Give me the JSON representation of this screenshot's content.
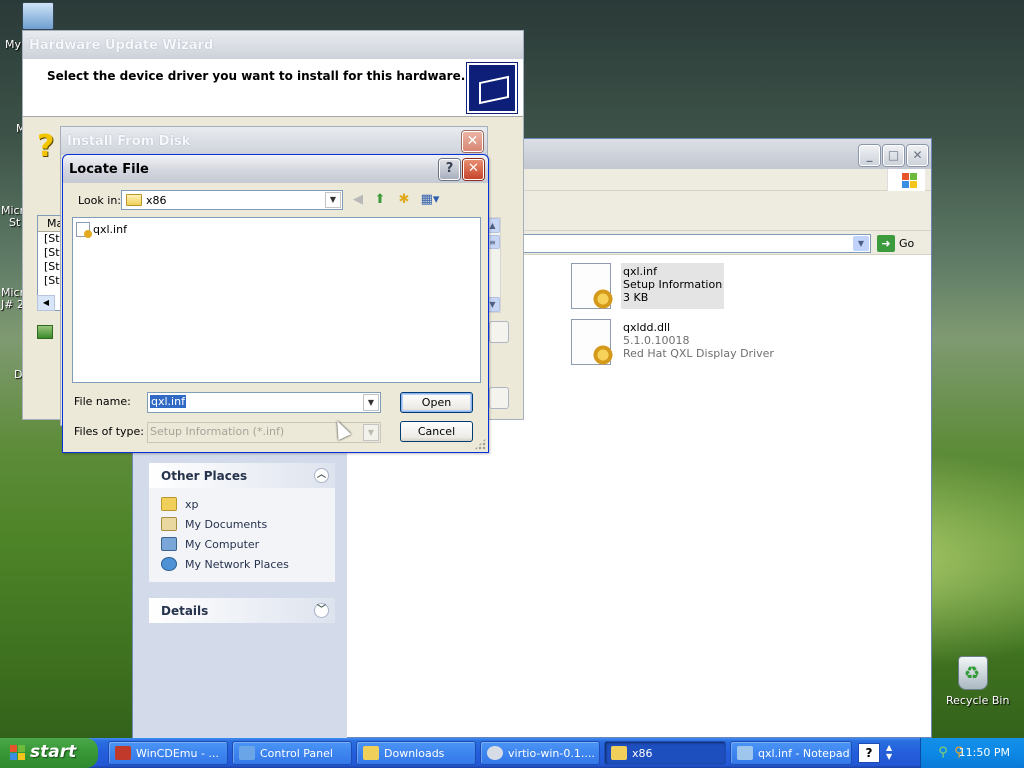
{
  "desktop": {
    "icons": [
      {
        "label": "My",
        "name": "my-computer"
      },
      {
        "label": "M",
        "name": "my-documents"
      },
      {
        "label": "Micr",
        "name": "ms-icon-1"
      },
      {
        "label": "St",
        "name": "ms-icon-1b"
      },
      {
        "label": "Micr",
        "name": "ms-icon-2"
      },
      {
        "label": "J# 2",
        "name": "ms-icon-2b"
      },
      {
        "label": "D",
        "name": "d-icon"
      }
    ],
    "recycle_bin": "Recycle Bin"
  },
  "explorer": {
    "go_label": "Go",
    "other_places": {
      "title": "Other Places",
      "items": [
        {
          "label": "xp",
          "icon": "folder-icon",
          "color": "#f0cf5b"
        },
        {
          "label": "My Documents",
          "icon": "my-documents-icon",
          "color": "#e9d9a0"
        },
        {
          "label": "My Computer",
          "icon": "my-computer-icon",
          "color": "#7aa6d8"
        },
        {
          "label": "My Network Places",
          "icon": "network-places-icon",
          "color": "#4f92d6"
        }
      ]
    },
    "details": {
      "title": "Details"
    },
    "files": [
      {
        "name": "qxl.inf",
        "line2": "Setup Information",
        "line3": "3 KB"
      },
      {
        "name": "qxldd.dll",
        "line2": "5.1.0.10018",
        "line3": "Red Hat QXL Display Driver"
      }
    ]
  },
  "wizard": {
    "title": "Hardware Update Wizard",
    "heading": "Select the device driver you want to install for this hardware.",
    "list_header": "Ma",
    "list_rows": [
      "[St",
      "[St",
      "[St",
      "[St"
    ]
  },
  "install_from_disk": {
    "title": "Install From Disk",
    "close": "✕"
  },
  "locate_file": {
    "title": "Locate File",
    "help": "?",
    "close": "✕",
    "look_in_label": "Look in:",
    "look_in_value": "x86",
    "files": [
      {
        "name": "qxl.inf"
      }
    ],
    "file_name_label": "File name:",
    "file_name_value": "qxl.inf",
    "files_of_type_label": "Files of type:",
    "files_of_type_value": "Setup Information (*.inf)",
    "open_label": "Open",
    "cancel_label": "Cancel"
  },
  "taskbar": {
    "start_label": "start",
    "tasks": [
      {
        "label": "WinCDEmu - ...",
        "icon": "wincdemu-icon",
        "color": "#c0392b"
      },
      {
        "label": "Control Panel",
        "icon": "control-panel-icon",
        "color": "#6aa5e8"
      },
      {
        "label": "Downloads",
        "icon": "folder-icon",
        "color": "#f0cf5b"
      },
      {
        "label": "virtio-win-0.1....",
        "icon": "cd-drive-icon",
        "color": "#d7dde6"
      },
      {
        "label": "x86",
        "icon": "folder-icon",
        "color": "#f0cf5b",
        "active": true
      },
      {
        "label": "qxl.inf - Notepad",
        "icon": "notepad-icon",
        "color": "#9fc7ee"
      }
    ],
    "help_glyph": "?",
    "clock": "11:50 PM"
  },
  "colors": {
    "xp_blue": "#245edb",
    "start_green": "#3a9a38",
    "task_link": "#215dc6",
    "selection": "#316ac5"
  }
}
